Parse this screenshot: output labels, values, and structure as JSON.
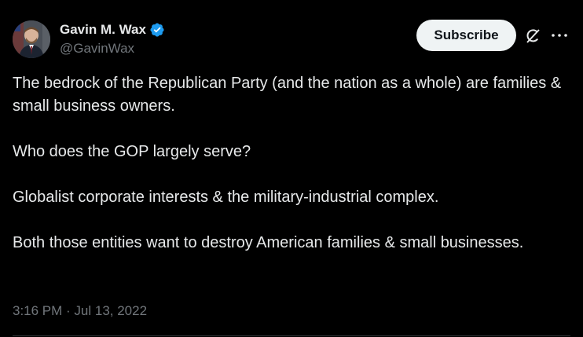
{
  "author": {
    "display_name": "Gavin M. Wax",
    "handle": "@GavinWax",
    "verified": true,
    "verified_color": "#1d9bf0"
  },
  "actions": {
    "subscribe_label": "Subscribe",
    "grok_icon": "grok-icon",
    "more_icon": "more-horizontal-icon"
  },
  "tweet": {
    "paragraphs": [
      "The bedrock of the Republican Party (and the nation as a whole) are families & small business owners.",
      "Who does the GOP largely serve?",
      "Globalist corporate interests & the military-industrial complex.",
      "Both those entities want to destroy American families & small businesses."
    ],
    "timestamp": "3:16 PM · Jul 13, 2022"
  },
  "colors": {
    "background": "#000000",
    "text_primary": "#e7e9ea",
    "text_secondary": "#71767b",
    "button_bg": "#eff3f4",
    "divider": "#2f3336"
  }
}
